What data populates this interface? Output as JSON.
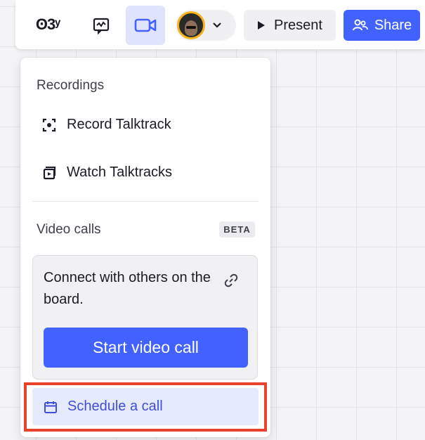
{
  "toolbar": {
    "reactions_text": "ʘ3ʸ",
    "present_label": "Present",
    "share_label": "Share",
    "icons": {
      "reactions": "reactions-icon",
      "chat": "chat-icon",
      "video": "video-camera-icon",
      "chevron": "chevron-down-icon",
      "play": "play-icon",
      "share": "people-icon"
    }
  },
  "panel": {
    "recordings_title": "Recordings",
    "record_label": "Record Talktrack",
    "watch_label": "Watch Talktracks",
    "video_calls_title": "Video calls",
    "beta_badge": "BETA",
    "connect_text": "Connect with others on the board.",
    "start_video_call_label": "Start video call",
    "schedule_label": "Schedule a call"
  },
  "colors": {
    "accent": "#4262ff",
    "active_tool_bg": "#dfe4fc",
    "schedule_bg": "#e6eafd",
    "schedule_text": "#3f4fd8",
    "highlight_border": "#e8412c"
  }
}
